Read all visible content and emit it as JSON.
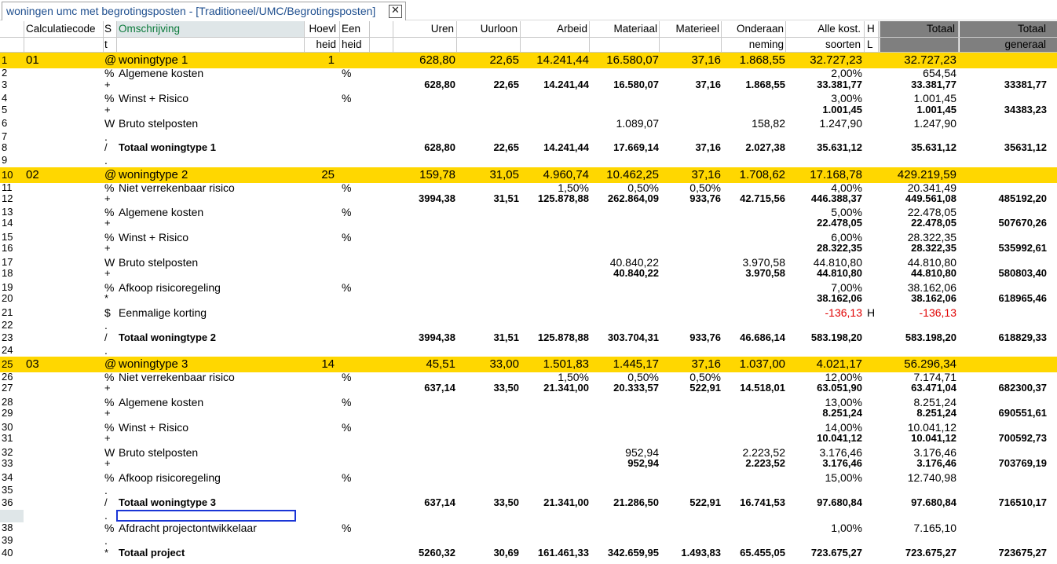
{
  "tab": {
    "title": "woningen umc met begrotingsposten - [Traditioneel/UMC/Begrotingsposten]",
    "close": "✕"
  },
  "header": {
    "row1": {
      "calc": "Calculatiecode",
      "s": "S",
      "omsch": "Omschrijving",
      "hoevl": "Hoevl",
      "een": "Een",
      "uren": "Uren",
      "uurloon": "Uurloon",
      "arbeid": "Arbeid",
      "materiaal": "Materiaal",
      "materieel": "Materieel",
      "onderaan": "Onderaan",
      "allekost": "Alle kost.",
      "h": "H",
      "totaal": "Totaal",
      "totaal2": "Totaal"
    },
    "row2": {
      "s": "t",
      "hoevl": "heid",
      "een": "heid",
      "onderaan": "neming",
      "allekost": "soorten",
      "h": "L",
      "totaal2": "generaal"
    }
  },
  "rows": [
    {
      "n": "1",
      "calc": "01",
      "s": "@",
      "omsch": "woningtype 1",
      "hoevl": "1",
      "een": "",
      "uren": "628,80",
      "uurloon": "22,65",
      "arbeid": "14.241,44",
      "materiaal": "16.580,07",
      "materieel": "37,16",
      "onderaan": "1.868,55",
      "allekost": "32.727,23",
      "h": "",
      "totaal": "32.727,23",
      "totaal2": "",
      "type": "yellow"
    },
    {
      "n": "2",
      "calc": "",
      "s": "%",
      "omsch": "Algemene kosten",
      "hoevl": "",
      "een": "%",
      "uren": "",
      "uurloon": "",
      "arbeid": "",
      "materiaal": "",
      "materieel": "",
      "onderaan": "",
      "allekost": "2,00%",
      "h": "",
      "totaal": "654,54",
      "totaal2": "",
      "type": "normal"
    },
    {
      "n": "3",
      "calc": "",
      "s": "+",
      "omsch": "",
      "hoevl": "",
      "een": "",
      "uren": "628,80",
      "uurloon": "22,65",
      "arbeid": "14.241,44",
      "materiaal": "16.580,07",
      "materieel": "37,16",
      "onderaan": "1.868,55",
      "allekost": "33.381,77",
      "h": "",
      "totaal": "33.381,77",
      "totaal2": "33381,77",
      "type": "bold"
    },
    {
      "n": "4",
      "calc": "",
      "s": "%",
      "omsch": "Winst + Risico",
      "hoevl": "",
      "een": "%",
      "uren": "",
      "uurloon": "",
      "arbeid": "",
      "materiaal": "",
      "materieel": "",
      "onderaan": "",
      "allekost": "3,00%",
      "h": "",
      "totaal": "1.001,45",
      "totaal2": "",
      "type": "normal"
    },
    {
      "n": "5",
      "calc": "",
      "s": "+",
      "omsch": "",
      "hoevl": "",
      "een": "",
      "uren": "",
      "uurloon": "",
      "arbeid": "",
      "materiaal": "",
      "materieel": "",
      "onderaan": "",
      "allekost": "1.001,45",
      "h": "",
      "totaal": "1.001,45",
      "totaal2": "34383,23",
      "type": "bold"
    },
    {
      "n": "6",
      "calc": "",
      "s": "W",
      "omsch": "Bruto stelposten",
      "hoevl": "",
      "een": "",
      "uren": "",
      "uurloon": "",
      "arbeid": "",
      "materiaal": "1.089,07",
      "materieel": "",
      "onderaan": "158,82",
      "allekost": "1.247,90",
      "h": "",
      "totaal": "1.247,90",
      "totaal2": "",
      "type": "normal"
    },
    {
      "n": "7",
      "calc": "",
      "s": ".",
      "omsch": "",
      "hoevl": "",
      "een": "",
      "uren": "",
      "uurloon": "",
      "arbeid": "",
      "materiaal": "",
      "materieel": "",
      "onderaan": "",
      "allekost": "",
      "h": "",
      "totaal": "",
      "totaal2": "",
      "type": "normal"
    },
    {
      "n": "8",
      "calc": "",
      "s": "/",
      "omsch": "Totaal woningtype 1",
      "hoevl": "",
      "een": "",
      "uren": "628,80",
      "uurloon": "22,65",
      "arbeid": "14.241,44",
      "materiaal": "17.669,14",
      "materieel": "37,16",
      "onderaan": "2.027,38",
      "allekost": "35.631,12",
      "h": "",
      "totaal": "35.631,12",
      "totaal2": "35631,12",
      "type": "bold"
    },
    {
      "n": "9",
      "calc": "",
      "s": ".",
      "omsch": "",
      "hoevl": "",
      "een": "",
      "uren": "",
      "uurloon": "",
      "arbeid": "",
      "materiaal": "",
      "materieel": "",
      "onderaan": "",
      "allekost": "",
      "h": "",
      "totaal": "",
      "totaal2": "",
      "type": "normal"
    },
    {
      "n": "10",
      "calc": "02",
      "s": "@",
      "omsch": "woningtype 2",
      "hoevl": "25",
      "een": "",
      "uren": "159,78",
      "uurloon": "31,05",
      "arbeid": "4.960,74",
      "materiaal": "10.462,25",
      "materieel": "37,16",
      "onderaan": "1.708,62",
      "allekost": "17.168,78",
      "h": "",
      "totaal": "429.219,59",
      "totaal2": "",
      "type": "yellow"
    },
    {
      "n": "11",
      "calc": "",
      "s": "%",
      "omsch": "Niet verrekenbaar risico",
      "hoevl": "",
      "een": "%",
      "uren": "",
      "uurloon": "",
      "arbeid": "1,50%",
      "materiaal": "0,50%",
      "materieel": "0,50%",
      "onderaan": "",
      "allekost": "4,00%",
      "h": "",
      "totaal": "20.341,49",
      "totaal2": "",
      "type": "normal"
    },
    {
      "n": "12",
      "calc": "",
      "s": "+",
      "omsch": "",
      "hoevl": "",
      "een": "",
      "uren": "3994,38",
      "uurloon": "31,51",
      "arbeid": "125.878,88",
      "materiaal": "262.864,09",
      "materieel": "933,76",
      "onderaan": "42.715,56",
      "allekost": "446.388,37",
      "h": "",
      "totaal": "449.561,08",
      "totaal2": "485192,20",
      "type": "bold"
    },
    {
      "n": "13",
      "calc": "",
      "s": "%",
      "omsch": "Algemene kosten",
      "hoevl": "",
      "een": "%",
      "uren": "",
      "uurloon": "",
      "arbeid": "",
      "materiaal": "",
      "materieel": "",
      "onderaan": "",
      "allekost": "5,00%",
      "h": "",
      "totaal": "22.478,05",
      "totaal2": "",
      "type": "normal"
    },
    {
      "n": "14",
      "calc": "",
      "s": "+",
      "omsch": "",
      "hoevl": "",
      "een": "",
      "uren": "",
      "uurloon": "",
      "arbeid": "",
      "materiaal": "",
      "materieel": "",
      "onderaan": "",
      "allekost": "22.478,05",
      "h": "",
      "totaal": "22.478,05",
      "totaal2": "507670,26",
      "type": "bold"
    },
    {
      "n": "15",
      "calc": "",
      "s": "%",
      "omsch": "Winst + Risico",
      "hoevl": "",
      "een": "%",
      "uren": "",
      "uurloon": "",
      "arbeid": "",
      "materiaal": "",
      "materieel": "",
      "onderaan": "",
      "allekost": "6,00%",
      "h": "",
      "totaal": "28.322,35",
      "totaal2": "",
      "type": "normal"
    },
    {
      "n": "16",
      "calc": "",
      "s": "+",
      "omsch": "",
      "hoevl": "",
      "een": "",
      "uren": "",
      "uurloon": "",
      "arbeid": "",
      "materiaal": "",
      "materieel": "",
      "onderaan": "",
      "allekost": "28.322,35",
      "h": "",
      "totaal": "28.322,35",
      "totaal2": "535992,61",
      "type": "bold"
    },
    {
      "n": "17",
      "calc": "",
      "s": "W",
      "omsch": "Bruto stelposten",
      "hoevl": "",
      "een": "",
      "uren": "",
      "uurloon": "",
      "arbeid": "",
      "materiaal": "40.840,22",
      "materieel": "",
      "onderaan": "3.970,58",
      "allekost": "44.810,80",
      "h": "",
      "totaal": "44.810,80",
      "totaal2": "",
      "type": "normal"
    },
    {
      "n": "18",
      "calc": "",
      "s": "+",
      "omsch": "",
      "hoevl": "",
      "een": "",
      "uren": "",
      "uurloon": "",
      "arbeid": "",
      "materiaal": "40.840,22",
      "materieel": "",
      "onderaan": "3.970,58",
      "allekost": "44.810,80",
      "h": "",
      "totaal": "44.810,80",
      "totaal2": "580803,40",
      "type": "bold"
    },
    {
      "n": "19",
      "calc": "",
      "s": "%",
      "omsch": "Afkoop risicoregeling",
      "hoevl": "",
      "een": "%",
      "uren": "",
      "uurloon": "",
      "arbeid": "",
      "materiaal": "",
      "materieel": "",
      "onderaan": "",
      "allekost": "7,00%",
      "h": "",
      "totaal": "38.162,06",
      "totaal2": "",
      "type": "normal"
    },
    {
      "n": "20",
      "calc": "",
      "s": "*",
      "omsch": "",
      "hoevl": "",
      "een": "",
      "uren": "",
      "uurloon": "",
      "arbeid": "",
      "materiaal": "",
      "materieel": "",
      "onderaan": "",
      "allekost": "38.162,06",
      "h": "",
      "totaal": "38.162,06",
      "totaal2": "618965,46",
      "type": "bold"
    },
    {
      "n": "21",
      "calc": "",
      "s": "$",
      "omsch": "Eenmalige korting",
      "hoevl": "",
      "een": "",
      "uren": "",
      "uurloon": "",
      "arbeid": "",
      "materiaal": "",
      "materieel": "",
      "onderaan": "",
      "allekost": "-136,13",
      "h": "H",
      "totaal": "-136,13",
      "totaal2": "",
      "type": "red"
    },
    {
      "n": "22",
      "calc": "",
      "s": ".",
      "omsch": "",
      "hoevl": "",
      "een": "",
      "uren": "",
      "uurloon": "",
      "arbeid": "",
      "materiaal": "",
      "materieel": "",
      "onderaan": "",
      "allekost": "",
      "h": "",
      "totaal": "",
      "totaal2": "",
      "type": "normal"
    },
    {
      "n": "23",
      "calc": "",
      "s": "/",
      "omsch": "Totaal woningtype 2",
      "hoevl": "",
      "een": "",
      "uren": "3994,38",
      "uurloon": "31,51",
      "arbeid": "125.878,88",
      "materiaal": "303.704,31",
      "materieel": "933,76",
      "onderaan": "46.686,14",
      "allekost": "583.198,20",
      "h": "",
      "totaal": "583.198,20",
      "totaal2": "618829,33",
      "type": "bold"
    },
    {
      "n": "24",
      "calc": "",
      "s": ".",
      "omsch": "",
      "hoevl": "",
      "een": "",
      "uren": "",
      "uurloon": "",
      "arbeid": "",
      "materiaal": "",
      "materieel": "",
      "onderaan": "",
      "allekost": "",
      "h": "",
      "totaal": "",
      "totaal2": "",
      "type": "normal"
    },
    {
      "n": "25",
      "calc": "03",
      "s": "@",
      "omsch": "woningtype 3",
      "hoevl": "14",
      "een": "",
      "uren": "45,51",
      "uurloon": "33,00",
      "arbeid": "1.501,83",
      "materiaal": "1.445,17",
      "materieel": "37,16",
      "onderaan": "1.037,00",
      "allekost": "4.021,17",
      "h": "",
      "totaal": "56.296,34",
      "totaal2": "",
      "type": "yellow"
    },
    {
      "n": "26",
      "calc": "",
      "s": "%",
      "omsch": "Niet verrekenbaar risico",
      "hoevl": "",
      "een": "%",
      "uren": "",
      "uurloon": "",
      "arbeid": "1,50%",
      "materiaal": "0,50%",
      "materieel": "0,50%",
      "onderaan": "",
      "allekost": "12,00%",
      "h": "",
      "totaal": "7.174,71",
      "totaal2": "",
      "type": "normal"
    },
    {
      "n": "27",
      "calc": "",
      "s": "+",
      "omsch": "",
      "hoevl": "",
      "een": "",
      "uren": "637,14",
      "uurloon": "33,50",
      "arbeid": "21.341,00",
      "materiaal": "20.333,57",
      "materieel": "522,91",
      "onderaan": "14.518,01",
      "allekost": "63.051,90",
      "h": "",
      "totaal": "63.471,04",
      "totaal2": "682300,37",
      "type": "bold"
    },
    {
      "n": "28",
      "calc": "",
      "s": "%",
      "omsch": "Algemene kosten",
      "hoevl": "",
      "een": "%",
      "uren": "",
      "uurloon": "",
      "arbeid": "",
      "materiaal": "",
      "materieel": "",
      "onderaan": "",
      "allekost": "13,00%",
      "h": "",
      "totaal": "8.251,24",
      "totaal2": "",
      "type": "normal"
    },
    {
      "n": "29",
      "calc": "",
      "s": "+",
      "omsch": "",
      "hoevl": "",
      "een": "",
      "uren": "",
      "uurloon": "",
      "arbeid": "",
      "materiaal": "",
      "materieel": "",
      "onderaan": "",
      "allekost": "8.251,24",
      "h": "",
      "totaal": "8.251,24",
      "totaal2": "690551,61",
      "type": "bold"
    },
    {
      "n": "30",
      "calc": "",
      "s": "%",
      "omsch": "Winst + Risico",
      "hoevl": "",
      "een": "%",
      "uren": "",
      "uurloon": "",
      "arbeid": "",
      "materiaal": "",
      "materieel": "",
      "onderaan": "",
      "allekost": "14,00%",
      "h": "",
      "totaal": "10.041,12",
      "totaal2": "",
      "type": "normal"
    },
    {
      "n": "31",
      "calc": "",
      "s": "+",
      "omsch": "",
      "hoevl": "",
      "een": "",
      "uren": "",
      "uurloon": "",
      "arbeid": "",
      "materiaal": "",
      "materieel": "",
      "onderaan": "",
      "allekost": "10.041,12",
      "h": "",
      "totaal": "10.041,12",
      "totaal2": "700592,73",
      "type": "bold"
    },
    {
      "n": "32",
      "calc": "",
      "s": "W",
      "omsch": "Bruto stelposten",
      "hoevl": "",
      "een": "",
      "uren": "",
      "uurloon": "",
      "arbeid": "",
      "materiaal": "952,94",
      "materieel": "",
      "onderaan": "2.223,52",
      "allekost": "3.176,46",
      "h": "",
      "totaal": "3.176,46",
      "totaal2": "",
      "type": "normal"
    },
    {
      "n": "33",
      "calc": "",
      "s": "+",
      "omsch": "",
      "hoevl": "",
      "een": "",
      "uren": "",
      "uurloon": "",
      "arbeid": "",
      "materiaal": "952,94",
      "materieel": "",
      "onderaan": "2.223,52",
      "allekost": "3.176,46",
      "h": "",
      "totaal": "3.176,46",
      "totaal2": "703769,19",
      "type": "bold"
    },
    {
      "n": "34",
      "calc": "",
      "s": "%",
      "omsch": "Afkoop risicoregeling",
      "hoevl": "",
      "een": "%",
      "uren": "",
      "uurloon": "",
      "arbeid": "",
      "materiaal": "",
      "materieel": "",
      "onderaan": "",
      "allekost": "15,00%",
      "h": "",
      "totaal": "12.740,98",
      "totaal2": "",
      "type": "normal"
    },
    {
      "n": "35",
      "calc": "",
      "s": ".",
      "omsch": "",
      "hoevl": "",
      "een": "",
      "uren": "",
      "uurloon": "",
      "arbeid": "",
      "materiaal": "",
      "materieel": "",
      "onderaan": "",
      "allekost": "",
      "h": "",
      "totaal": "",
      "totaal2": "",
      "type": "normal"
    },
    {
      "n": "36",
      "calc": "",
      "s": "/",
      "omsch": "Totaal woningtype 3",
      "hoevl": "",
      "een": "",
      "uren": "637,14",
      "uurloon": "33,50",
      "arbeid": "21.341,00",
      "materiaal": "21.286,50",
      "materieel": "522,91",
      "onderaan": "16.741,53",
      "allekost": "97.680,84",
      "h": "",
      "totaal": "97.680,84",
      "totaal2": "716510,17",
      "type": "bold"
    },
    {
      "n": "37",
      "calc": "",
      "s": ".",
      "omsch": "",
      "hoevl": "",
      "een": "",
      "uren": "",
      "uurloon": "",
      "arbeid": "",
      "materiaal": "",
      "materieel": "",
      "onderaan": "",
      "allekost": "",
      "h": "",
      "totaal": "",
      "totaal2": "",
      "type": "normal"
    },
    {
      "n": "38",
      "calc": "",
      "s": "%",
      "omsch": "Afdracht projectontwikkelaar",
      "hoevl": "",
      "een": "%",
      "uren": "",
      "uurloon": "",
      "arbeid": "",
      "materiaal": "",
      "materieel": "",
      "onderaan": "",
      "allekost": "1,00%",
      "h": "",
      "totaal": "7.165,10",
      "totaal2": "",
      "type": "normal"
    },
    {
      "n": "39",
      "calc": "",
      "s": ".",
      "omsch": "",
      "hoevl": "",
      "een": "",
      "uren": "",
      "uurloon": "",
      "arbeid": "",
      "materiaal": "",
      "materieel": "",
      "onderaan": "",
      "allekost": "",
      "h": "",
      "totaal": "",
      "totaal2": "",
      "type": "normal"
    },
    {
      "n": "40",
      "calc": "",
      "s": "*",
      "omsch": "Totaal project",
      "hoevl": "",
      "een": "",
      "uren": "5260,32",
      "uurloon": "30,69",
      "arbeid": "161.461,33",
      "materiaal": "342.659,95",
      "materieel": "1.493,83",
      "onderaan": "65.455,05",
      "allekost": "723.675,27",
      "h": "",
      "totaal": "723.675,27",
      "totaal2": "723675,27",
      "type": "bold"
    }
  ],
  "colors": {
    "highlight_row": "#ffd700",
    "header_dark": "#7f7f7f",
    "negative": "#e00000",
    "selection": "#1a35d6",
    "omschrijving_header": "#0b7a3b"
  }
}
